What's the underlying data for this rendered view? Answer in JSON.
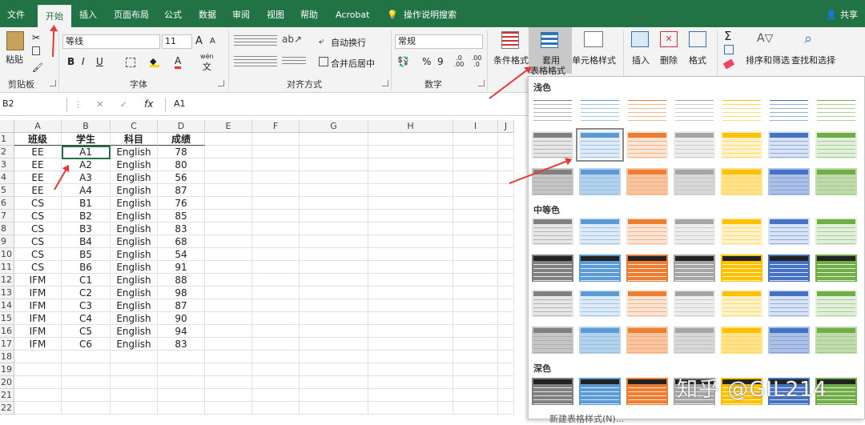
{
  "tabs": [
    "文件",
    "开始",
    "插入",
    "页面布局",
    "公式",
    "数据",
    "审阅",
    "视图",
    "帮助",
    "Acrobat"
  ],
  "tell_me": "操作说明搜索",
  "share": "共享",
  "clipboard": {
    "paste": "粘贴",
    "group": "剪贴板"
  },
  "font": {
    "name": "等线",
    "size": "11",
    "group": "字体",
    "bold": "B",
    "italic": "I",
    "underline": "U",
    "grow": "A",
    "shrink": "A",
    "color_a": "A",
    "wen": "wén",
    "wen_char": "文"
  },
  "align": {
    "wrap": "自动换行",
    "merge": "合并后居中",
    "group": "对齐方式"
  },
  "number": {
    "format": "常规",
    "group": "数字",
    "percent": "%",
    "comma": "9",
    "inc": ".0 .00",
    "dec": ".00 .0"
  },
  "styles": {
    "cond": "条件格式",
    "table_line1": "套用",
    "table_line2": "表格格式",
    "cell": "单元格样式"
  },
  "cells": {
    "insert": "插入",
    "delete": "删除",
    "format": "格式"
  },
  "editing": {
    "sigma": "Σ",
    "sort": "排序和筛选",
    "find": "查找和选择"
  },
  "formula_bar": {
    "namebox": "B2",
    "fx": "fx",
    "cancel": "✕",
    "enter": "✓",
    "value": "A1"
  },
  "columns": [
    "A",
    "B",
    "C",
    "D",
    "E",
    "F",
    "G",
    "H",
    "I",
    "J"
  ],
  "rows": [
    "1",
    "2",
    "3",
    "4",
    "5",
    "6",
    "7",
    "8",
    "9",
    "10",
    "11",
    "12",
    "13",
    "14",
    "15",
    "16",
    "17",
    "18",
    "19",
    "20",
    "21",
    "22"
  ],
  "table": {
    "headers": [
      "班级",
      "学生",
      "科目",
      "成绩"
    ],
    "rows": [
      [
        "EE",
        "A1",
        "English",
        "78"
      ],
      [
        "EE",
        "A2",
        "English",
        "80"
      ],
      [
        "EE",
        "A3",
        "English",
        "56"
      ],
      [
        "EE",
        "A4",
        "English",
        "87"
      ],
      [
        "CS",
        "B1",
        "English",
        "76"
      ],
      [
        "CS",
        "B2",
        "English",
        "85"
      ],
      [
        "CS",
        "B3",
        "English",
        "83"
      ],
      [
        "CS",
        "B4",
        "English",
        "68"
      ],
      [
        "CS",
        "B5",
        "English",
        "54"
      ],
      [
        "CS",
        "B6",
        "English",
        "91"
      ],
      [
        "IFM",
        "C1",
        "English",
        "88"
      ],
      [
        "IFM",
        "C2",
        "English",
        "98"
      ],
      [
        "IFM",
        "C3",
        "English",
        "87"
      ],
      [
        "IFM",
        "C4",
        "English",
        "90"
      ],
      [
        "IFM",
        "C5",
        "English",
        "94"
      ],
      [
        "IFM",
        "C6",
        "English",
        "83"
      ]
    ]
  },
  "gallery": {
    "light": "浅色",
    "medium": "中等色",
    "dark": "深色",
    "new_style": "新建表格样式(N)..."
  },
  "watermark": "知乎 @GIL214",
  "colors": {
    "theme": "#217346",
    "swatches": [
      "#808080",
      "#5b9bd5",
      "#ed7d31",
      "#a5a5a5",
      "#ffc000",
      "#4472c4",
      "#70ad47"
    ]
  }
}
